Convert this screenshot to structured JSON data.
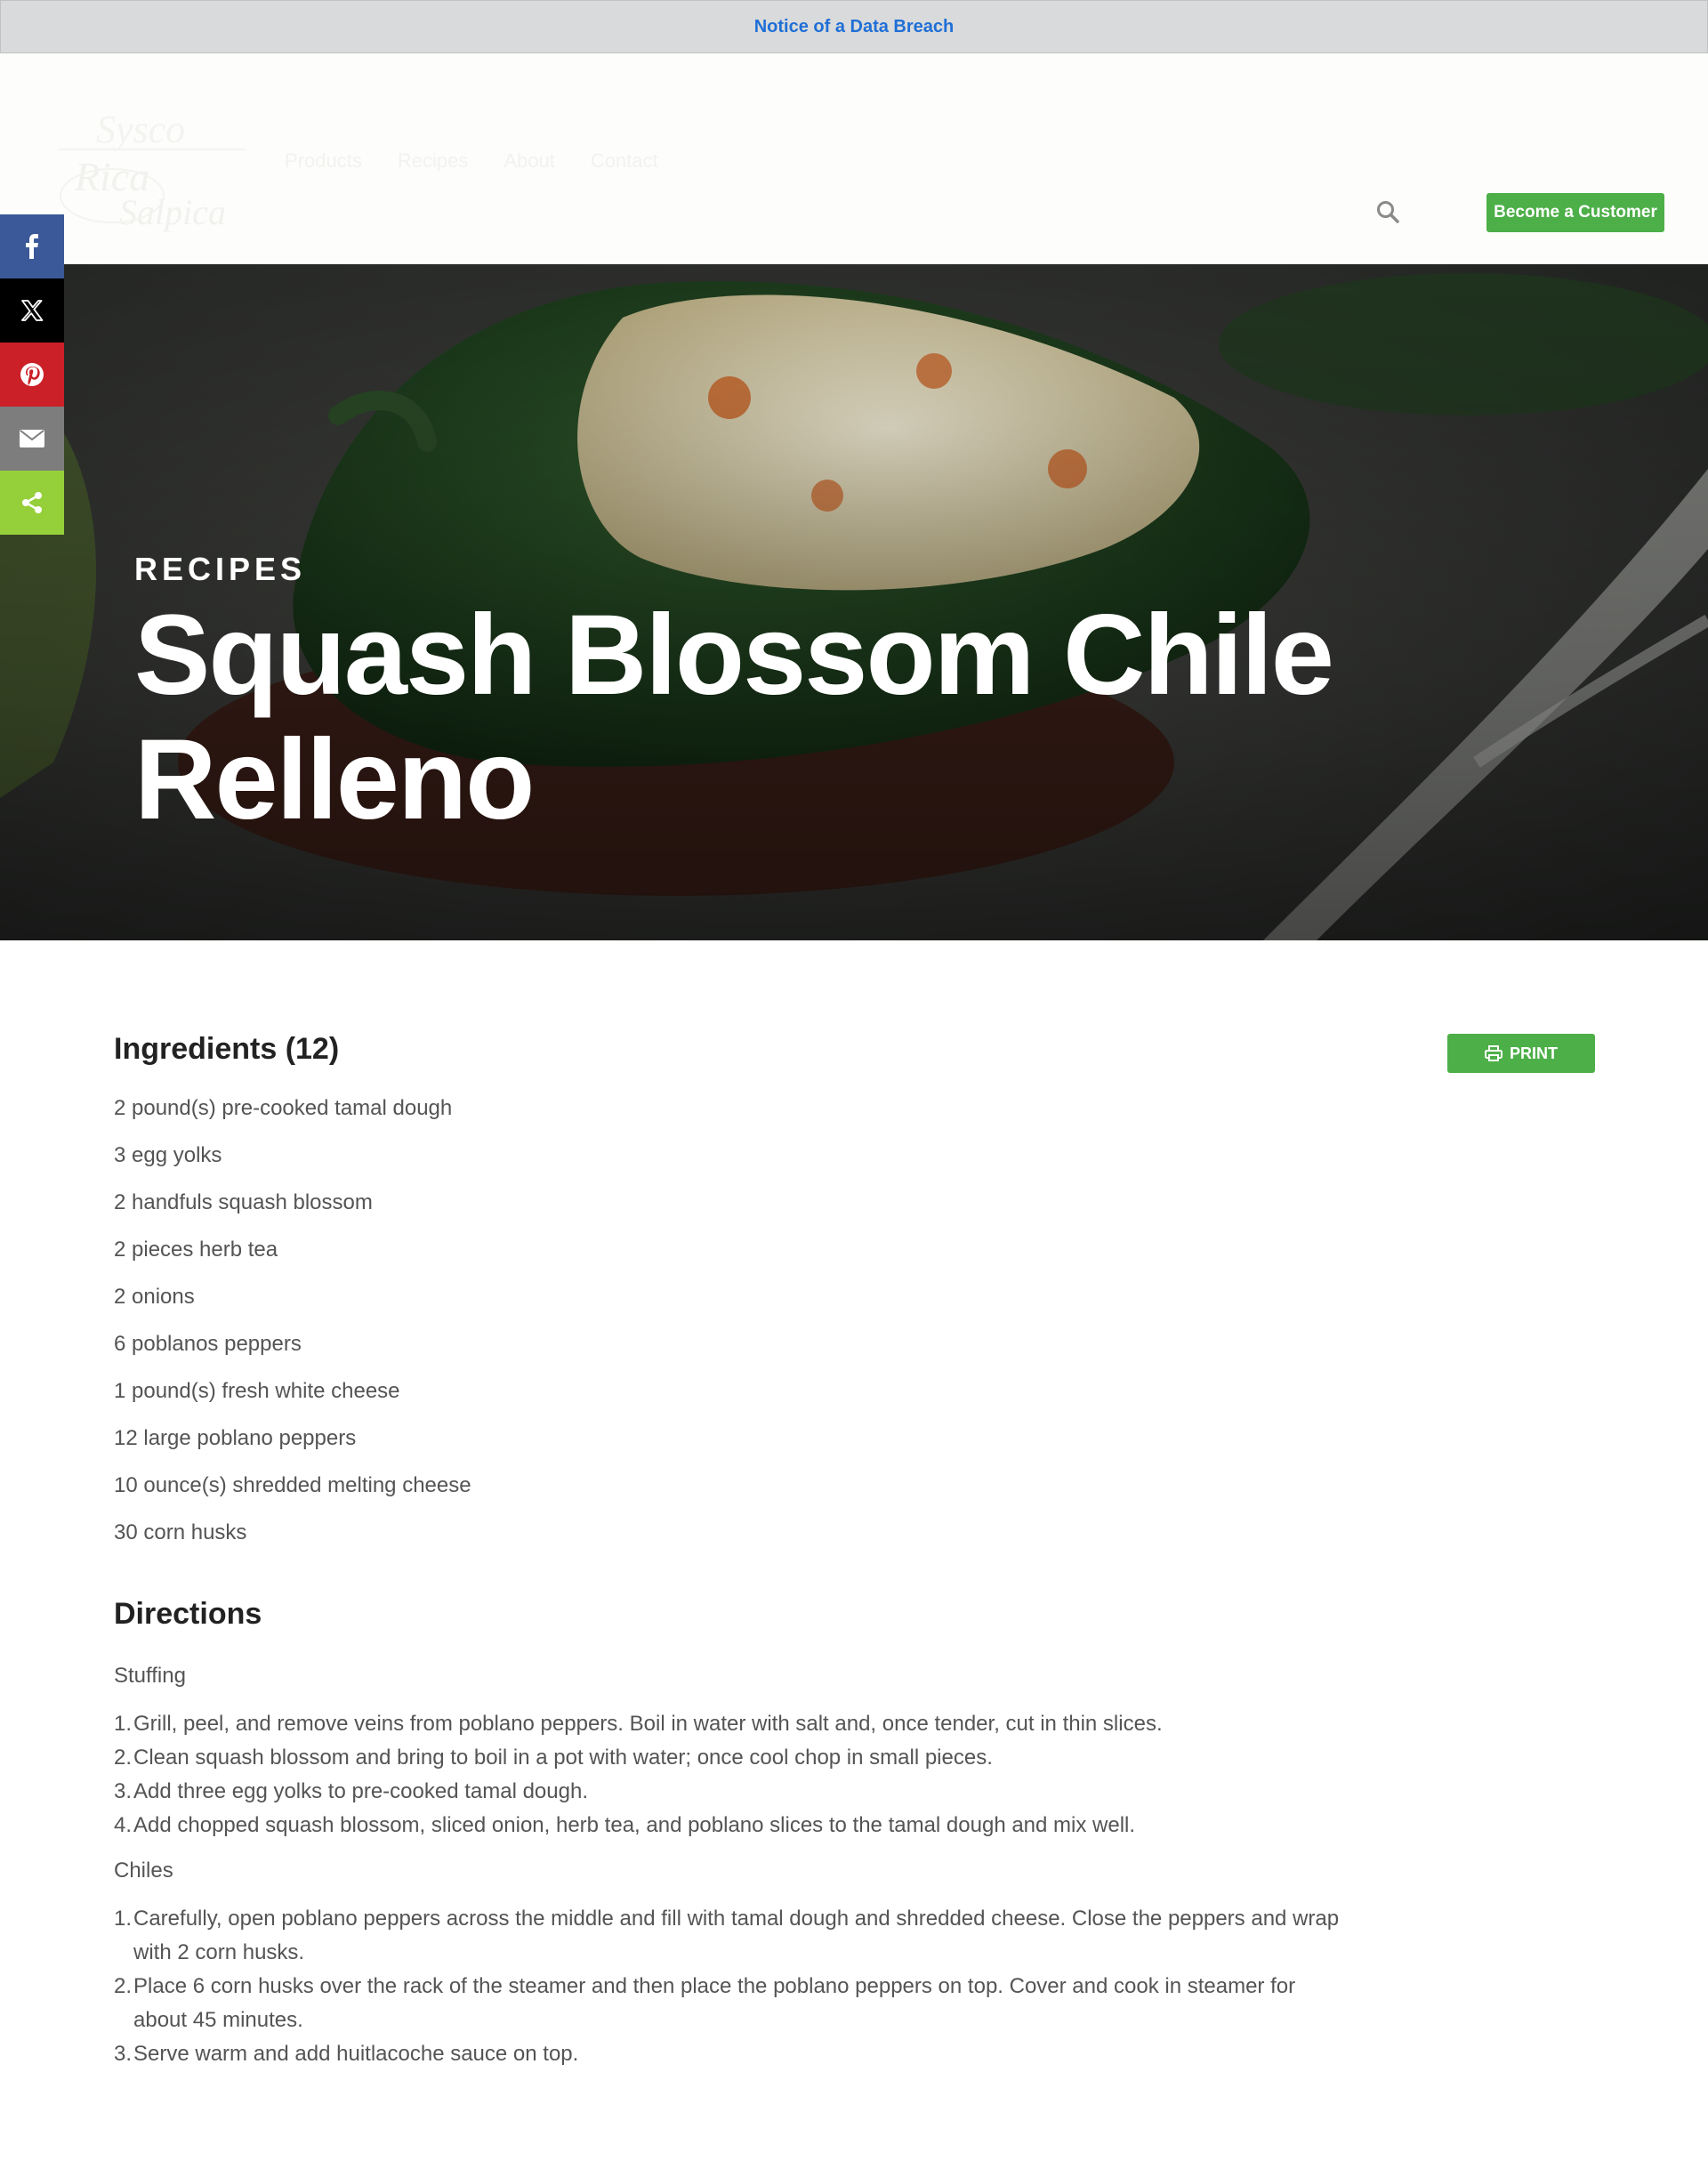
{
  "notice": {
    "text": "Notice of a Data Breach"
  },
  "header": {
    "logo_text": "Sysco Rica Salpica",
    "nav": [
      "Products",
      "Recipes",
      "About",
      "Contact"
    ],
    "cta_label": "Become a Customer"
  },
  "share": {
    "items": [
      "facebook-icon",
      "x-icon",
      "pinterest-icon",
      "email-icon",
      "share-icon"
    ]
  },
  "hero": {
    "eyebrow": "RECIPES",
    "title": "Squash Blossom Chile Relleno"
  },
  "ingredients": {
    "title": "Ingredients (12)",
    "print_label": "PRINT",
    "items": [
      "2 pound(s) pre-cooked tamal dough",
      "3 egg yolks",
      "2 handfuls squash blossom",
      "2 pieces herb tea",
      "2 onions",
      "6 poblanos peppers",
      "1 pound(s) fresh white cheese",
      "12 large poblano peppers",
      "10 ounce(s) shredded melting cheese",
      "30 corn husks"
    ]
  },
  "directions": {
    "title": "Directions",
    "sections": [
      {
        "label": "Stuffing",
        "steps": [
          "Grill, peel, and remove veins from poblano peppers. Boil in water with salt and, once tender, cut in thin slices.",
          "Clean squash blossom and bring to boil in a pot with water; once cool chop in small pieces.",
          "Add three egg yolks to pre-cooked tamal dough.",
          "Add chopped squash blossom, sliced onion, herb tea, and poblano slices to the tamal dough and mix well."
        ]
      },
      {
        "label": "Chiles",
        "steps": [
          "Carefully, open poblano peppers across the middle and fill with tamal dough and shredded cheese. Close the peppers and wrap with 2 corn husks.",
          "Place 6 corn husks over the rack of the steamer and then place the poblano peppers on top. Cover and cook in steamer for about 45 minutes.",
          "Serve warm and add huitlacoche sauce on top."
        ]
      }
    ]
  },
  "colors": {
    "accent": "#4daf48",
    "link": "#1f6fd6",
    "facebook": "#3b5998",
    "pinterest": "#cb2027",
    "share": "#95d03a"
  }
}
